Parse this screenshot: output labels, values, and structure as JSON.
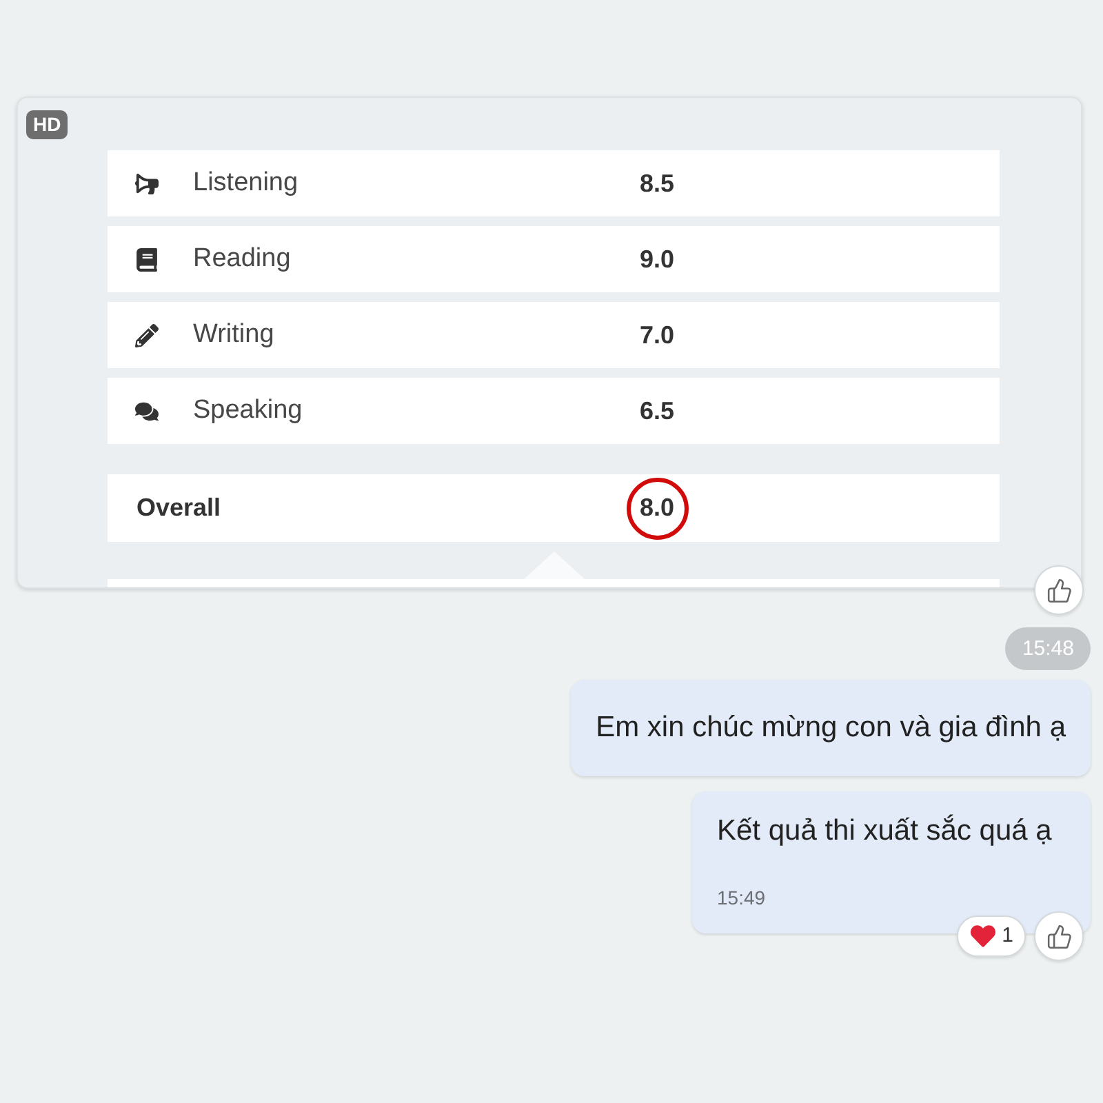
{
  "image_message": {
    "badge": "HD",
    "like_button": true,
    "scores": [
      {
        "kind": "listening",
        "skill": "Listening",
        "score": "8.5"
      },
      {
        "kind": "reading",
        "skill": "Reading",
        "score": "9.0"
      },
      {
        "kind": "writing",
        "skill": "Writing",
        "score": "7.0"
      },
      {
        "kind": "speaking",
        "skill": "Speaking",
        "score": "6.5"
      }
    ],
    "overall": {
      "label": "Overall",
      "score": "8.0",
      "circled": true
    }
  },
  "timestamp": "15:48",
  "messages": [
    {
      "text": "Em xin chúc mừng con và gia đình ạ",
      "like_button": false
    },
    {
      "text": "Kết quả thi xuất sắc quá ạ",
      "time": "15:49",
      "like_button": true,
      "reactions": [
        {
          "kind": "heart",
          "count": "1"
        }
      ]
    }
  ]
}
